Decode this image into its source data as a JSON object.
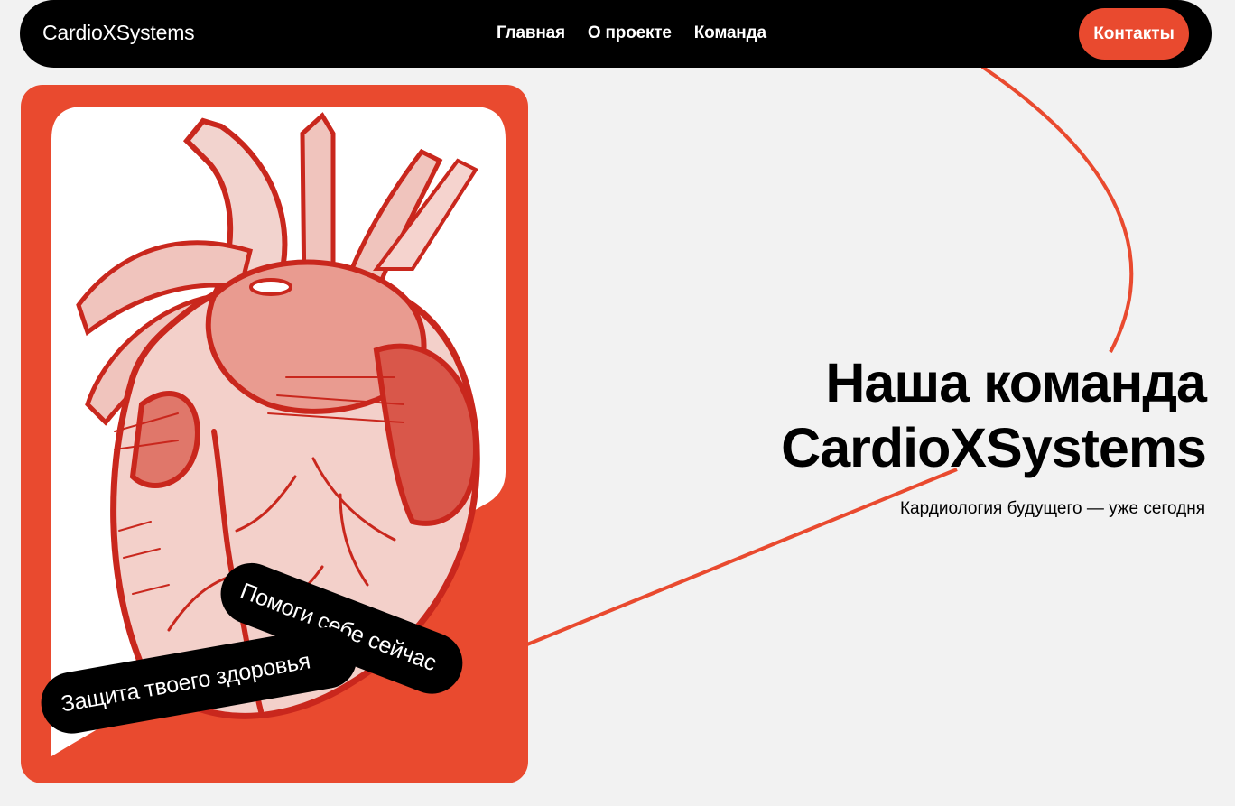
{
  "header": {
    "brand": "CardioXSystems",
    "nav": [
      "Главная",
      "О проекте",
      "Команда"
    ],
    "contact_label": "Контакты"
  },
  "hero": {
    "title_line1": "Наша команда",
    "title_line2": "CardioXSystems",
    "tagline": "Кардиология будущего — уже сегодня"
  },
  "card": {
    "image_subject": "anatomical heart illustration",
    "tag_help": "Помоги себе сейчас",
    "tag_protect": "Защита твоего здоровья"
  },
  "colors": {
    "accent": "#e94a2f",
    "dark": "#000000",
    "background": "#f2f2f2",
    "illustration": "#c9271d"
  }
}
